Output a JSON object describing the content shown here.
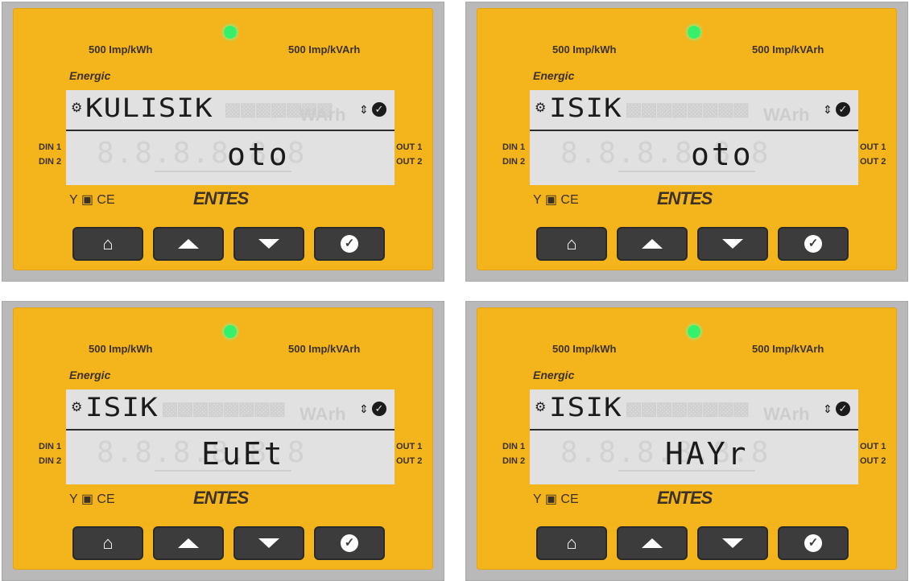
{
  "colors": {
    "face": "#f4b41c",
    "led": "#35f06a",
    "button": "#3c3c3c",
    "lcd_background": "#e1e1e1"
  },
  "panels": [
    {
      "imp_kwh": "500 Imp/kWh",
      "imp_kvarh": "500 Imp/kVArh",
      "brand_top": "Energic",
      "lcd_top": "KULISIK",
      "lcd_bottom": "oto",
      "din1": "DIN 1",
      "din2": "DIN 2",
      "out1": "OUT 1",
      "out2": "OUT 2",
      "brand_bottom": "ENTES",
      "cert": "CE"
    },
    {
      "imp_kwh": "500 Imp/kWh",
      "imp_kvarh": "500 Imp/kVArh",
      "brand_top": "Energic",
      "lcd_top": "ISIK",
      "lcd_bottom": "oto",
      "din1": "DIN 1",
      "din2": "DIN 2",
      "out1": "OUT 1",
      "out2": "OUT 2",
      "brand_bottom": "ENTES",
      "cert": "CE"
    },
    {
      "imp_kwh": "500 Imp/kWh",
      "imp_kvarh": "500 Imp/kVArh",
      "brand_top": "Energic",
      "lcd_top": "ISIK",
      "lcd_bottom": "EuEt",
      "din1": "DIN 1",
      "din2": "DIN 2",
      "out1": "OUT 1",
      "out2": "OUT 2",
      "brand_bottom": "ENTES",
      "cert": "CE"
    },
    {
      "imp_kwh": "500 Imp/kWh",
      "imp_kvarh": "500 Imp/kVArh",
      "brand_top": "Energic",
      "lcd_top": "ISIK",
      "lcd_bottom": "HAYr",
      "din1": "DIN 1",
      "din2": "DIN 2",
      "out1": "OUT 1",
      "out2": "OUT 2",
      "brand_bottom": "ENTES",
      "cert": "CE"
    }
  ]
}
